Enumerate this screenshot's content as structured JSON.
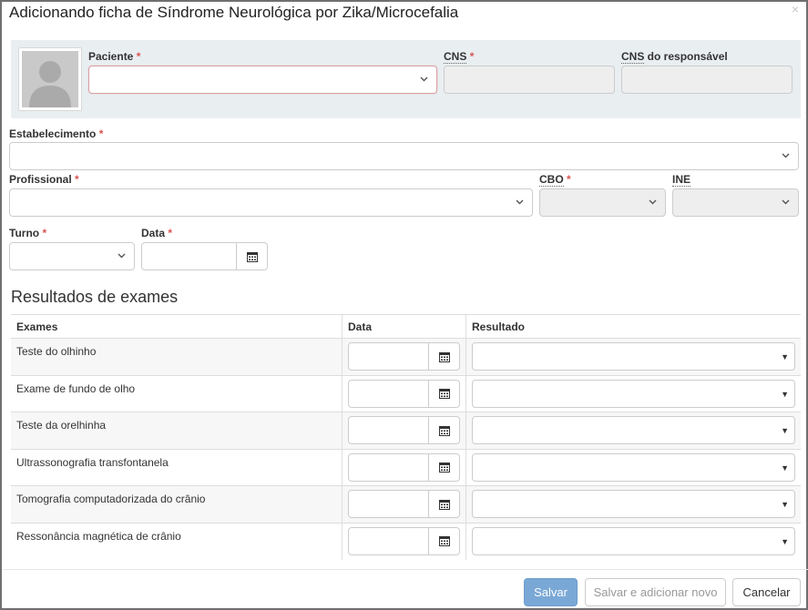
{
  "modal": {
    "title": "Adicionando ficha de Síndrome Neurológica por Zika/Microcefalia",
    "close_glyph": "×"
  },
  "patient": {
    "avatar_icon": "user-silhouette-icon",
    "paciente_label": "Paciente",
    "paciente_value": "",
    "cns_label": "CNS",
    "cns_value": "",
    "cns_responsavel_abbr": "CNS",
    "cns_responsavel_label": " do responsável",
    "cns_responsavel_value": ""
  },
  "form": {
    "required_mark": "*",
    "estabelecimento_label": "Estabelecimento",
    "estabelecimento_value": "",
    "profissional_label": "Profissional",
    "profissional_value": "",
    "cbo_label": "CBO",
    "cbo_value": "",
    "ine_label": "INE",
    "ine_value": "",
    "turno_label": "Turno",
    "turno_value": "",
    "data_label": "Data",
    "data_value": ""
  },
  "exams_section": {
    "title": "Resultados de exames",
    "columns": [
      "Exames",
      "Data",
      "Resultado"
    ],
    "rows": [
      {
        "name": "Teste do olhinho",
        "date": "",
        "result": ""
      },
      {
        "name": "Exame de fundo de olho",
        "date": "",
        "result": ""
      },
      {
        "name": "Teste da orelhinha",
        "date": "",
        "result": ""
      },
      {
        "name": "Ultrassonografia transfontanela",
        "date": "",
        "result": ""
      },
      {
        "name": "Tomografia computadorizada do crânio",
        "date": "",
        "result": ""
      },
      {
        "name": "Ressonância magnética de crânio",
        "date": "",
        "result": ""
      }
    ]
  },
  "footer": {
    "save_label": "Salvar",
    "save_and_new_label": "Salvar e adicionar novo",
    "cancel_label": "Cancelar"
  },
  "colors": {
    "required": "#d9534f",
    "panel_bg": "#e9eef1",
    "primary_button": "#7aa8d6"
  },
  "icons": {
    "select_caret": "chevron-down-icon",
    "date_picker": "calendar-icon",
    "native_select": "triangle-down-icon"
  }
}
